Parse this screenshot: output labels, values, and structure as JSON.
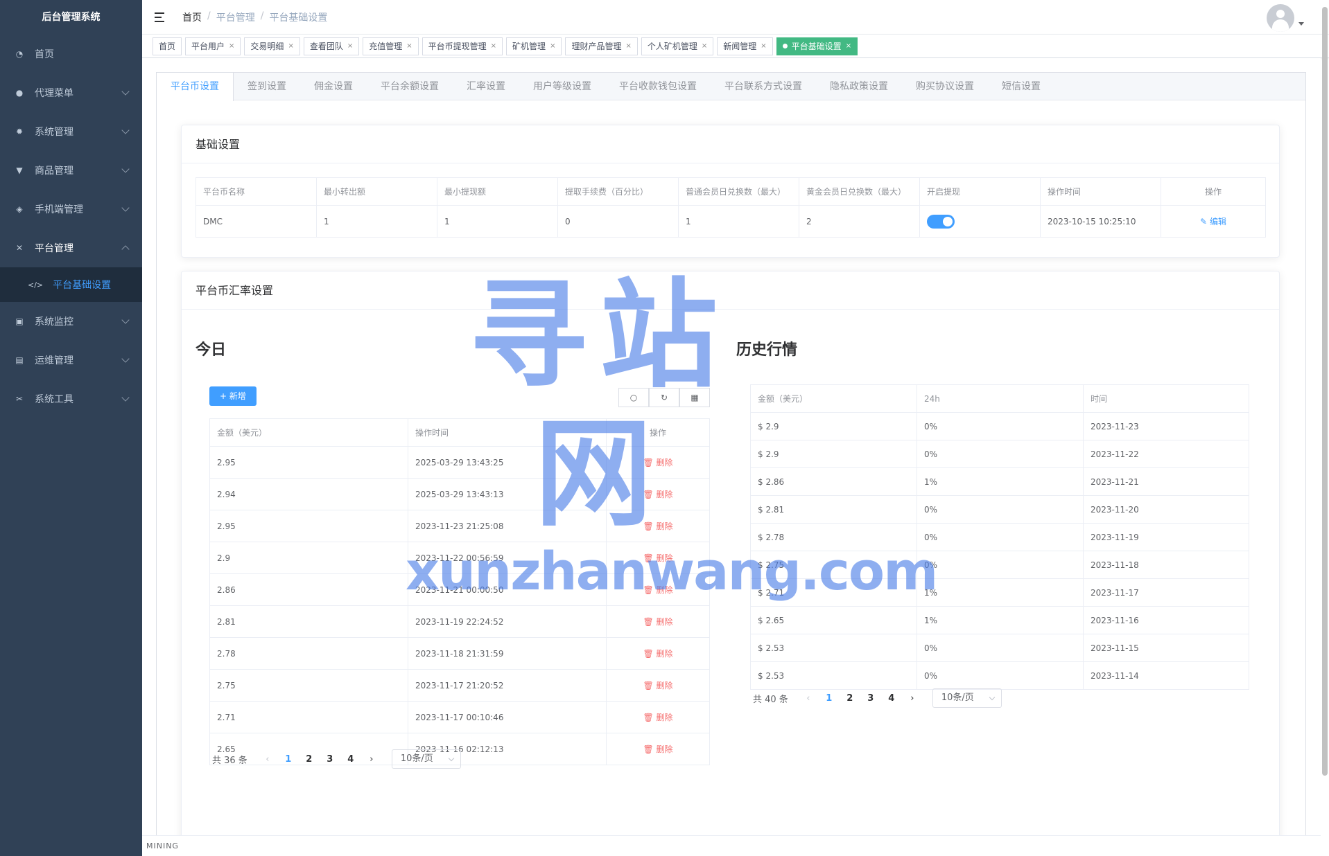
{
  "sidebar": {
    "brand": "后台管理系统",
    "items": [
      {
        "label": "首页",
        "icon": "dashboard-icon"
      },
      {
        "label": "代理菜单",
        "icon": "user-icon"
      },
      {
        "label": "系统管理",
        "icon": "gear-icon"
      },
      {
        "label": "商品管理",
        "icon": "cart-icon"
      },
      {
        "label": "手机端管理",
        "icon": "cube-icon"
      },
      {
        "label": "平台管理",
        "icon": "tools-icon"
      },
      {
        "label": "系统监控",
        "icon": "monitor-icon"
      },
      {
        "label": "运维管理",
        "icon": "server-icon"
      },
      {
        "label": "系统工具",
        "icon": "wrench-icon"
      }
    ],
    "sub_item": "平台基础设置"
  },
  "breadcrumb": [
    "首页",
    "平台管理",
    "平台基础设置"
  ],
  "tags": [
    {
      "label": "首页"
    },
    {
      "label": "平台用户"
    },
    {
      "label": "交易明细"
    },
    {
      "label": "查看团队"
    },
    {
      "label": "充值管理"
    },
    {
      "label": "平台币提现管理"
    },
    {
      "label": "矿机管理"
    },
    {
      "label": "理财产品管理"
    },
    {
      "label": "个人矿机管理"
    },
    {
      "label": "新闻管理"
    },
    {
      "label": "平台基础设置"
    }
  ],
  "tabs": [
    "平台币设置",
    "签到设置",
    "佣金设置",
    "平台余额设置",
    "汇率设置",
    "用户等级设置",
    "平台收款钱包设置",
    "平台联系方式设置",
    "隐私政策设置",
    "购买协议设置",
    "短信设置"
  ],
  "basic": {
    "title": "基础设置",
    "headers": [
      "平台币名称",
      "最小转出额",
      "最小提现额",
      "提取手续费（百分比）",
      "普通会员日兑换数（最大）",
      "黄金会员日兑换数（最大）",
      "开启提现",
      "操作时间",
      "操作"
    ],
    "row": {
      "name": "DMC",
      "min_transfer": "1",
      "min_withdraw": "1",
      "fee": "0",
      "normal_max": "1",
      "gold_max": "2",
      "time": "2023-10-15 10:25:10",
      "edit": "编辑"
    }
  },
  "rate": {
    "title": "平台币汇率设置",
    "today_title": "今日",
    "history_title": "历史行情",
    "add_label": "新增",
    "today_headers": [
      "金额（美元）",
      "操作时间",
      "操作"
    ],
    "today_rows": [
      {
        "amount": "2.95",
        "time": "2025-03-29 13:43:25"
      },
      {
        "amount": "2.94",
        "time": "2025-03-29 13:43:13"
      },
      {
        "amount": "2.95",
        "time": "2023-11-23 21:25:08"
      },
      {
        "amount": "2.9",
        "time": "2023-11-22 00:56:59"
      },
      {
        "amount": "2.86",
        "time": "2023-11-21 00:00:50"
      },
      {
        "amount": "2.81",
        "time": "2023-11-19 22:24:52"
      },
      {
        "amount": "2.78",
        "time": "2023-11-18 21:31:59"
      },
      {
        "amount": "2.75",
        "time": "2023-11-17 21:20:52"
      },
      {
        "amount": "2.71",
        "time": "2023-11-17 00:10:46"
      },
      {
        "amount": "2.65",
        "time": "2023-11-16 02:12:13"
      }
    ],
    "delete_label": "删除",
    "today_pager": {
      "total": "共 36 条",
      "pages": [
        "1",
        "2",
        "3",
        "4"
      ],
      "size": "10条/页"
    },
    "history_headers": [
      "金额（美元）",
      "24h",
      "时间"
    ],
    "history_rows": [
      {
        "amount": "$ 2.9",
        "change": "0%",
        "date": "2023-11-23"
      },
      {
        "amount": "$ 2.9",
        "change": "0%",
        "date": "2023-11-22"
      },
      {
        "amount": "$ 2.86",
        "change": "1%",
        "date": "2023-11-21"
      },
      {
        "amount": "$ 2.81",
        "change": "0%",
        "date": "2023-11-20"
      },
      {
        "amount": "$ 2.78",
        "change": "0%",
        "date": "2023-11-19"
      },
      {
        "amount": "$ 2.75",
        "change": "0%",
        "date": "2023-11-18"
      },
      {
        "amount": "$ 2.71",
        "change": "1%",
        "date": "2023-11-17"
      },
      {
        "amount": "$ 2.65",
        "change": "1%",
        "date": "2023-11-16"
      },
      {
        "amount": "$ 2.53",
        "change": "0%",
        "date": "2023-11-15"
      },
      {
        "amount": "$ 2.53",
        "change": "0%",
        "date": "2023-11-14"
      }
    ],
    "history_pager": {
      "total": "共 40 条",
      "pages": [
        "1",
        "2",
        "3",
        "4"
      ],
      "size": "10条/页"
    }
  },
  "footer": "MINING",
  "watermark": {
    "cn": "寻站网",
    "en": "xunzhanwang.com"
  },
  "colors": {
    "primary": "#409eff",
    "sidebar": "#304156",
    "tag_active": "#42b983",
    "danger": "#f56c6c"
  }
}
